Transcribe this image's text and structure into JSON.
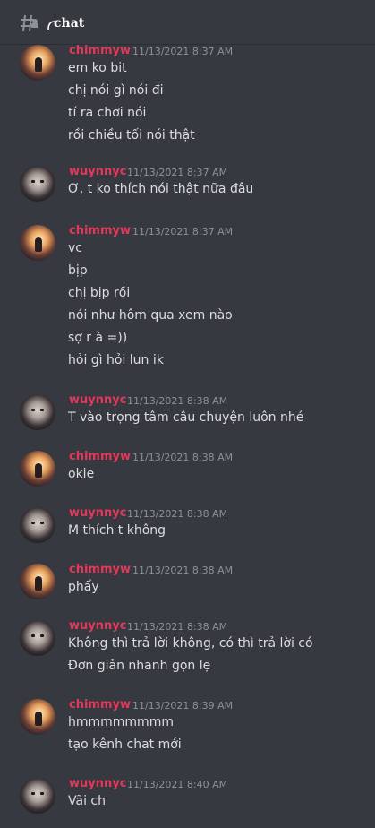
{
  "channel": {
    "name": "chat",
    "icon": "hash-thread-icon"
  },
  "messages": [
    {
      "user": "chimmyw",
      "time": "11/13/2021 8:37 AM",
      "avatar": "sunset-avatar",
      "lines": [
        "em ko bit",
        "chị nói gì nói đi",
        "tí ra chơi nói",
        "rồi chiều tối nói thật"
      ]
    },
    {
      "user": "wuynnyc",
      "time": "11/13/2021 8:37 AM",
      "avatar": "portrait-avatar",
      "lines": [
        "Ơ, t ko thích nói thật nữa đâu"
      ]
    },
    {
      "user": "chimmyw",
      "time": "11/13/2021 8:37 AM",
      "avatar": "sunset-avatar",
      "lines": [
        "vc",
        "bịp",
        "chị bịp rồi",
        "nói như hôm qua xem nào",
        "sợ r à =))",
        "hỏi gì hỏi lun ik"
      ]
    },
    {
      "user": "wuynnyc",
      "time": "11/13/2021 8:38 AM",
      "avatar": "portrait-avatar",
      "lines": [
        "T vào trọng tâm câu chuyện luôn nhé"
      ]
    },
    {
      "user": "chimmyw",
      "time": "11/13/2021 8:38 AM",
      "avatar": "sunset-avatar",
      "lines": [
        "okie"
      ]
    },
    {
      "user": "wuynnyc",
      "time": "11/13/2021 8:38 AM",
      "avatar": "portrait-avatar",
      "lines": [
        "M thích t không"
      ]
    },
    {
      "user": "chimmyw",
      "time": "11/13/2021 8:38 AM",
      "avatar": "sunset-avatar",
      "lines": [
        "phẩy"
      ]
    },
    {
      "user": "wuynnyc",
      "time": "11/13/2021 8:38 AM",
      "avatar": "portrait-avatar",
      "lines": [
        "Không thì trả lời không, có thì trả lời có",
        "Đơn giản nhanh gọn lẹ"
      ]
    },
    {
      "user": "chimmyw",
      "time": "11/13/2021 8:39 AM",
      "avatar": "sunset-avatar",
      "lines": [
        "hmmmmmmmm",
        "tạo kênh chat mới"
      ]
    },
    {
      "user": "wuynnyc",
      "time": "11/13/2021 8:40 AM",
      "avatar": "portrait-avatar",
      "lines": [
        "Vãi ch"
      ]
    }
  ],
  "colors": {
    "background": "#36393f",
    "username": "#e3385b",
    "timestamp": "#8e9297",
    "text": "#dcddde"
  }
}
